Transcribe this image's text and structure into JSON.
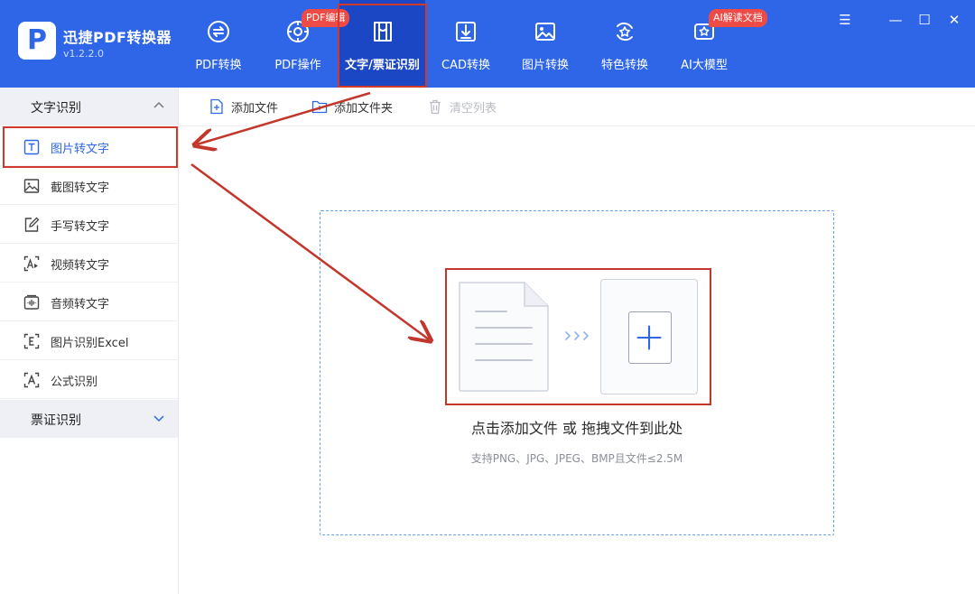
{
  "app": {
    "name": "迅捷PDF转换器",
    "version": "v1.2.2.0",
    "logo_letter": "P"
  },
  "nav": {
    "tabs": [
      {
        "label": "PDF转换",
        "icon": "pdf-convert-icon"
      },
      {
        "label": "PDF操作",
        "icon": "pdf-operate-icon"
      },
      {
        "label": "文字/票证识别",
        "icon": "ocr-icon",
        "active": true
      },
      {
        "label": "CAD转换",
        "icon": "cad-icon"
      },
      {
        "label": "图片转换",
        "icon": "image-icon"
      },
      {
        "label": "特色转换",
        "icon": "special-icon"
      },
      {
        "label": "AI大模型",
        "icon": "ai-icon"
      }
    ],
    "badges": {
      "pdf_edit": "PDF编辑",
      "ai_read": "AI解读文档"
    }
  },
  "window_controls": {
    "menu": "☰",
    "minimize": "—",
    "maximize": "☐",
    "close": "✕"
  },
  "sidebar": {
    "group_text": {
      "label": "文字识别",
      "expanded": true
    },
    "items": [
      {
        "label": "图片转文字",
        "icon": "text-t-icon",
        "active": true
      },
      {
        "label": "截图转文字",
        "icon": "screenshot-icon"
      },
      {
        "label": "手写转文字",
        "icon": "handwrite-icon"
      },
      {
        "label": "视频转文字",
        "icon": "video-text-icon"
      },
      {
        "label": "音频转文字",
        "icon": "audio-icon"
      },
      {
        "label": "图片识别Excel",
        "icon": "excel-icon"
      },
      {
        "label": "公式识别",
        "icon": "formula-icon"
      }
    ],
    "group_ticket": {
      "label": "票证识别",
      "expanded": false
    }
  },
  "toolbar": {
    "add_file": "添加文件",
    "add_folder": "添加文件夹",
    "clear_list": "清空列表"
  },
  "dropzone": {
    "title": "点击添加文件 或 拖拽文件到此处",
    "hint": "支持PNG、JPG、JPEG、BMP且文件≤2.5M"
  },
  "colors": {
    "header_blue": "#2f66e8",
    "active_tab": "#1b47c5",
    "badge_red": "#ef4b46",
    "annotation_red": "#c3362b",
    "dash_blue": "#6aa4e8"
  }
}
